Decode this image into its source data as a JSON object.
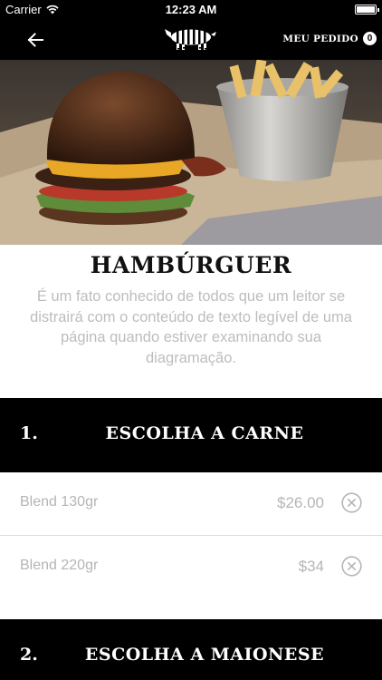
{
  "status_bar": {
    "carrier": "Carrier",
    "time": "12:23 AM",
    "wifi_icon": "wifi-icon",
    "battery_icon": "battery-icon"
  },
  "nav": {
    "back_icon": "arrow-left-icon",
    "logo_icon": "zebra-logo",
    "order_label": "MEU PEDIDO",
    "order_count": "0"
  },
  "product": {
    "title": "HAMBÚRGUER",
    "description": "É um fato conhecido de todos que um leitor se distrairá com o conteúdo de texto legível de uma página quando estiver examinando sua diagramação."
  },
  "sections": [
    {
      "number": "1.",
      "title": "ESCOLHA A CARNE",
      "options": [
        {
          "name": "Blend 130gr",
          "price": "$26.00",
          "icon": "close-circle-icon"
        },
        {
          "name": "Blend 220gr",
          "price": "$34",
          "icon": "close-circle-icon"
        }
      ]
    },
    {
      "number": "2.",
      "title": "ESCOLHA A MAIONESE",
      "options": []
    }
  ],
  "colors": {
    "header_bg": "#000000",
    "muted_text": "#b5b5b5",
    "divider": "#dcdcdc"
  }
}
